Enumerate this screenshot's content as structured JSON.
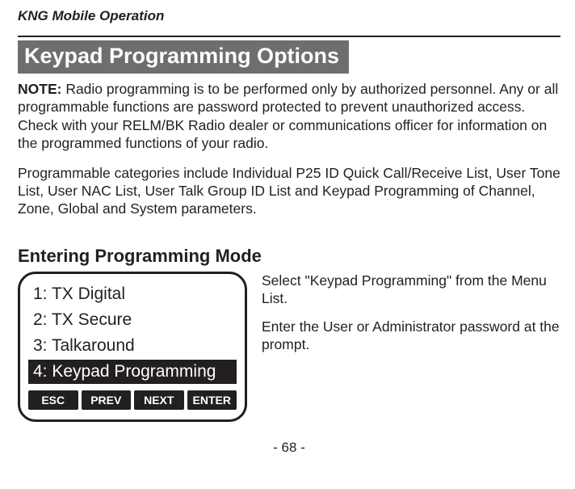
{
  "running_head": "KNG Mobile Operation",
  "section_title": "Keypad Programming Options",
  "note_label": "NOTE:",
  "note_text": " Radio programming is to be performed only by authorized personnel. Any or all programmable functions are password protected to prevent unauthorized access. Check with your RELM/BK Radio dealer or communications officer for information on the programmed functions of your radio.",
  "body_para2": "Programmable categories include Individual P25 ID Quick Call/Receive  List, User Tone List, User NAC List, User Talk Group ID List and Keypad Programming of Channel, Zone, Global and System parameters.",
  "subheading": "Entering Programming Mode",
  "menu": {
    "items": [
      {
        "label": "1: TX Digital",
        "selected": false
      },
      {
        "label": "2: TX Secure",
        "selected": false
      },
      {
        "label": "3: Talkaround",
        "selected": false
      },
      {
        "label": "4: Keypad Programming",
        "selected": true
      }
    ],
    "softkeys": [
      "ESC",
      "PREV",
      "NEXT",
      "ENTER"
    ]
  },
  "side_para1": "Select \"Keypad Programming\" from the Menu List.",
  "side_para2": "Enter the User or Administrator password at the prompt.",
  "page_number": "- 68 -"
}
